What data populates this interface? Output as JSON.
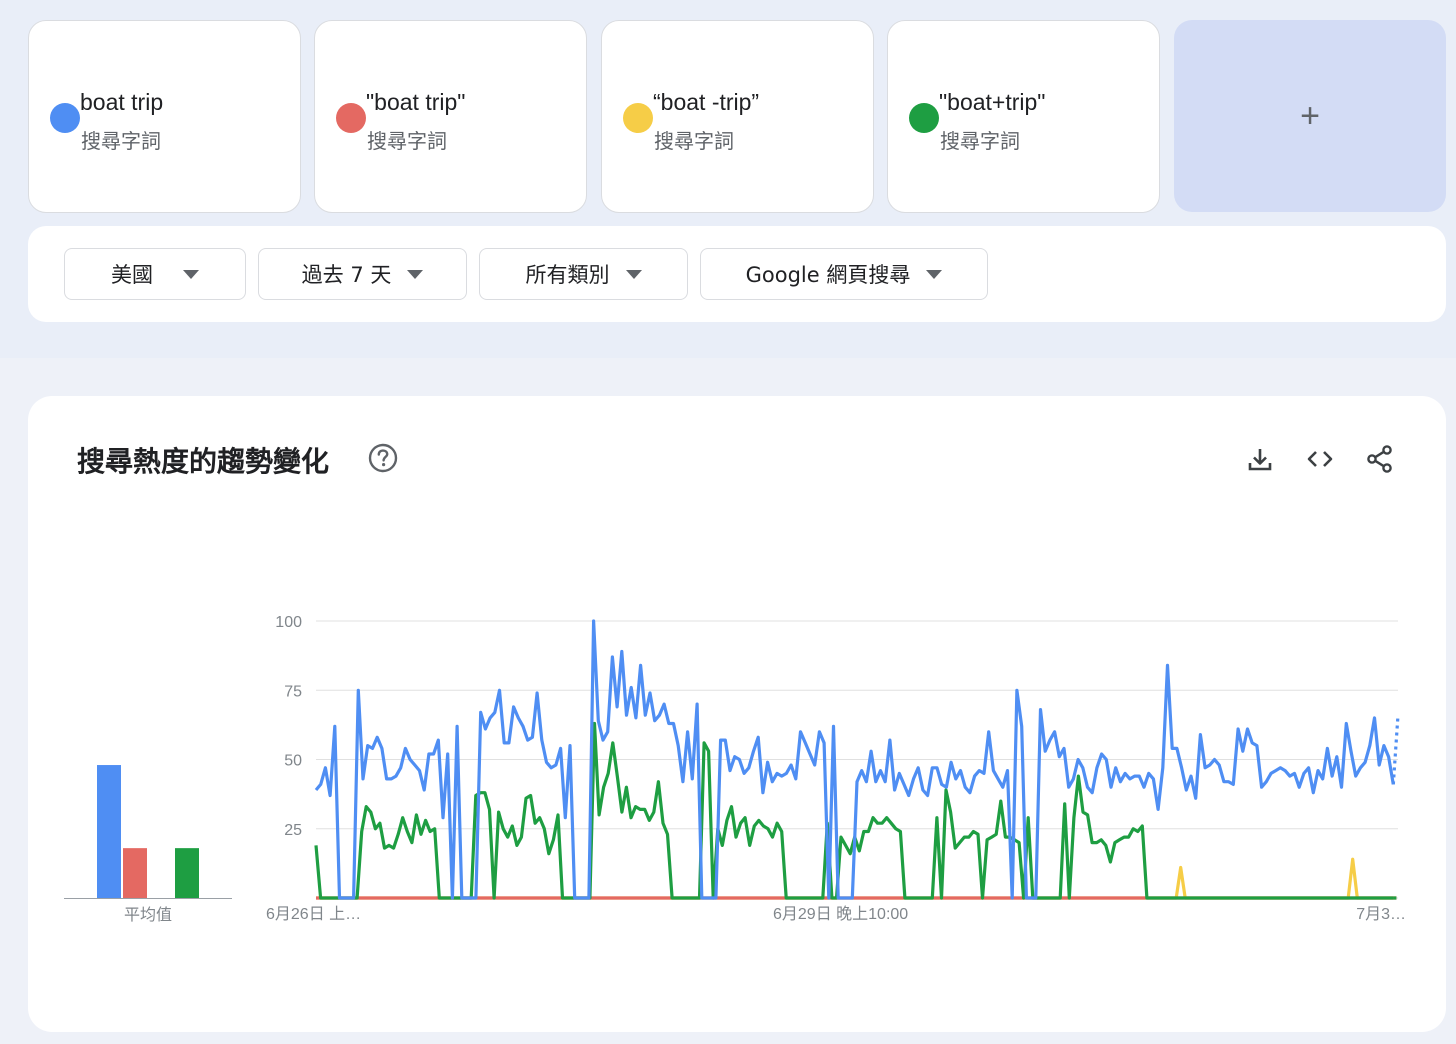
{
  "terms": [
    {
      "label": "boat trip",
      "sub": "搜尋字詞",
      "color": "#4f8ef3"
    },
    {
      "label": "\"boat trip\"",
      "sub": "搜尋字詞",
      "color": "#e46962"
    },
    {
      "label": "“boat -trip”",
      "sub": "搜尋字詞",
      "color": "#f6cd47"
    },
    {
      "label": "\"boat+trip\"",
      "sub": "搜尋字詞",
      "color": "#1e9e42"
    }
  ],
  "add_label": "+",
  "filters": {
    "region": "美國",
    "time": "過去 7 天",
    "category": "所有類別",
    "source": "Google 網頁搜尋"
  },
  "section_title": "搜尋熱度的趨勢變化",
  "icons": {
    "help": "help-circle-icon",
    "download": "download-icon",
    "embed": "code-icon",
    "share": "share-icon"
  },
  "chart_data": [
    {
      "type": "bar",
      "categories": [
        "boat trip",
        "\"boat trip\"",
        "“boat -trip”",
        "\"boat+trip\""
      ],
      "values": [
        48,
        18,
        0,
        18
      ],
      "colors": [
        "#4f8ef3",
        "#e46962",
        "#f6cd47",
        "#1e9e42"
      ],
      "xlabel": "平均值",
      "ylim": [
        0,
        100
      ]
    },
    {
      "type": "line",
      "ylim": [
        0,
        100
      ],
      "yticks": [
        100,
        75,
        50,
        25
      ],
      "xtick_labels": [
        "6月26日 上…",
        "6月29日 晚上10:00",
        "7月3…"
      ],
      "grid": true,
      "last_segment_dotted": true,
      "series": [
        {
          "name": "boat trip",
          "color": "#4f8ef3",
          "values": [
            39,
            41,
            47,
            37,
            62,
            0,
            0,
            0,
            0,
            75,
            43,
            55,
            54,
            58,
            54,
            43,
            43,
            44,
            47,
            54,
            50,
            48,
            46,
            39,
            52,
            52,
            57,
            29,
            52,
            0,
            62,
            0,
            0,
            0,
            0,
            67,
            61,
            65,
            67,
            75,
            56,
            56,
            69,
            65,
            62,
            57,
            58,
            74,
            57,
            49,
            47,
            48,
            54,
            29,
            55,
            0,
            0,
            0,
            0,
            100,
            64,
            57,
            60,
            87,
            69,
            89,
            66,
            76,
            65,
            84,
            66,
            74,
            64,
            66,
            70,
            63,
            63,
            55,
            42,
            60,
            43,
            70,
            0,
            0,
            0,
            0,
            57,
            57,
            46,
            51,
            50,
            45,
            47,
            53,
            58,
            38,
            49,
            42,
            45,
            44,
            45,
            48,
            43,
            60,
            56,
            52,
            48,
            60,
            56,
            0,
            62,
            0,
            0,
            0,
            0,
            42,
            46,
            42,
            53,
            42,
            46,
            42,
            57,
            39,
            45,
            41,
            37,
            43,
            47,
            39,
            37,
            47,
            47,
            41,
            40,
            49,
            43,
            46,
            40,
            38,
            44,
            46,
            45,
            60,
            46,
            43,
            40,
            46,
            0,
            75,
            62,
            0,
            0,
            0,
            68,
            53,
            57,
            60,
            51,
            54,
            40,
            43,
            50,
            47,
            40,
            38,
            47,
            52,
            50,
            40,
            47,
            42,
            45,
            43,
            44,
            44,
            40,
            45,
            43,
            32,
            47,
            84,
            54,
            54,
            47,
            39,
            44,
            36,
            59,
            47,
            48,
            50,
            48,
            42,
            42,
            41,
            61,
            53,
            61,
            56,
            55,
            40,
            42,
            45,
            46,
            47,
            46,
            44,
            45,
            40,
            45,
            47,
            38,
            46,
            43,
            54,
            44,
            51,
            40,
            63,
            53,
            44,
            47,
            49,
            55,
            65,
            48,
            55,
            51,
            41,
            66
          ]
        },
        {
          "name": "\"boat trip\"",
          "color": "#e46962",
          "values": [
            0,
            0,
            0,
            0,
            0,
            0,
            0,
            0,
            0,
            0,
            0,
            0,
            0,
            0,
            0,
            0,
            0,
            0,
            0,
            0,
            0,
            0,
            0,
            0,
            0,
            0,
            0,
            0,
            0,
            0,
            0,
            0,
            0,
            0,
            0,
            0,
            0,
            0,
            0,
            0,
            0,
            0,
            0,
            0,
            0,
            0,
            0,
            0,
            0,
            0,
            0,
            0,
            0,
            0,
            0,
            0,
            0,
            0,
            0,
            0,
            0,
            0,
            0,
            0,
            0,
            0,
            0,
            0,
            0,
            0,
            0,
            0,
            0,
            0,
            0,
            0,
            0,
            0,
            0,
            0,
            0,
            0,
            0,
            0,
            0,
            0,
            0,
            0,
            0,
            0,
            0,
            0,
            0,
            0,
            0,
            0,
            0,
            0,
            0,
            0,
            0,
            0,
            0,
            0,
            0,
            0,
            0,
            0,
            0,
            0,
            0,
            0,
            0,
            0,
            0,
            0,
            0,
            0,
            0,
            0,
            0,
            0,
            0,
            0,
            0,
            0,
            0,
            0,
            0,
            0,
            0,
            0,
            0,
            0,
            0,
            0,
            0,
            0,
            0,
            0,
            0,
            0,
            0,
            0,
            0,
            0,
            0,
            0,
            0,
            0,
            0,
            0,
            0,
            0,
            0,
            0,
            0,
            0,
            0,
            0,
            0,
            0,
            0,
            0,
            0,
            0,
            0,
            0,
            0,
            0,
            0,
            0,
            0,
            0,
            0,
            0,
            0,
            0,
            0,
            0,
            0,
            0,
            0,
            0,
            0,
            0,
            0,
            0,
            0,
            0,
            0,
            0,
            0,
            0,
            0,
            0,
            0,
            0,
            0,
            0,
            0,
            0,
            0,
            0,
            0,
            0,
            0,
            0,
            0,
            0,
            0,
            0,
            0,
            0,
            0,
            0,
            0,
            0,
            0,
            0,
            0,
            0,
            0,
            0,
            0,
            0,
            0,
            0,
            0,
            0,
            0,
            0,
            0,
            0,
            0,
            0,
            0,
            0,
            0,
            0
          ]
        },
        {
          "name": "“boat -trip”",
          "color": "#f6cd47",
          "values": [
            0,
            0,
            0,
            0,
            0,
            0,
            0,
            0,
            0,
            0,
            0,
            0,
            0,
            0,
            0,
            0,
            0,
            0,
            0,
            0,
            0,
            0,
            0,
            0,
            0,
            0,
            0,
            0,
            0,
            0,
            0,
            0,
            0,
            0,
            0,
            0,
            0,
            0,
            0,
            0,
            0,
            0,
            0,
            0,
            0,
            0,
            0,
            0,
            0,
            0,
            0,
            0,
            0,
            0,
            0,
            0,
            0,
            0,
            0,
            0,
            0,
            0,
            0,
            0,
            0,
            0,
            0,
            0,
            0,
            0,
            0,
            0,
            0,
            0,
            0,
            0,
            0,
            0,
            0,
            0,
            0,
            0,
            0,
            0,
            0,
            0,
            0,
            0,
            0,
            0,
            0,
            0,
            0,
            0,
            0,
            0,
            0,
            0,
            0,
            0,
            0,
            0,
            0,
            0,
            0,
            0,
            0,
            0,
            0,
            0,
            0,
            0,
            0,
            0,
            0,
            0,
            0,
            0,
            0,
            0,
            0,
            0,
            0,
            0,
            0,
            0,
            0,
            0,
            0,
            0,
            0,
            0,
            0,
            0,
            0,
            0,
            0,
            0,
            0,
            0,
            0,
            0,
            0,
            0,
            0,
            0,
            0,
            0,
            0,
            0,
            0,
            0,
            0,
            0,
            0,
            0,
            0,
            0,
            0,
            0,
            0,
            0,
            0,
            0,
            0,
            0,
            0,
            0,
            0,
            0,
            0,
            0,
            0,
            0,
            0,
            0,
            0,
            0,
            0,
            0,
            0,
            0,
            0,
            0,
            0,
            0,
            0,
            0,
            0,
            0,
            0,
            11,
            0,
            0,
            0,
            0,
            0,
            0,
            0,
            0,
            0,
            0,
            0,
            0,
            0,
            0,
            0,
            0,
            0,
            0,
            0,
            0,
            0,
            0,
            0,
            0,
            0,
            0,
            0,
            0,
            0,
            0,
            0,
            0,
            0,
            0,
            0,
            0,
            0,
            14,
            0,
            0,
            0,
            0,
            0,
            0,
            0,
            0,
            0,
            0
          ]
        },
        {
          "name": "\"boat+trip\"",
          "color": "#1e9e42",
          "values": [
            19,
            0,
            0,
            0,
            0,
            0,
            0,
            0,
            0,
            0,
            24,
            33,
            31,
            25,
            27,
            18,
            19,
            18,
            23,
            29,
            24,
            20,
            30,
            23,
            28,
            24,
            25,
            0,
            0,
            0,
            0,
            0,
            0,
            0,
            0,
            37,
            38,
            38,
            32,
            0,
            31,
            25,
            22,
            26,
            19,
            22,
            36,
            37,
            27,
            29,
            25,
            16,
            21,
            30,
            0,
            0,
            0,
            0,
            0,
            0,
            0,
            63,
            30,
            40,
            45,
            56,
            44,
            31,
            40,
            29,
            33,
            32,
            32,
            28,
            31,
            42,
            27,
            23,
            0,
            0,
            0,
            0,
            0,
            0,
            0,
            56,
            53,
            0,
            25,
            19,
            28,
            33,
            22,
            27,
            29,
            19,
            26,
            28,
            26,
            25,
            22,
            27,
            24,
            0,
            0,
            0,
            0,
            0,
            0,
            0,
            0,
            0,
            27,
            0,
            0,
            22,
            19,
            16,
            22,
            17,
            24,
            24,
            29,
            27,
            27,
            29,
            27,
            25,
            24,
            0,
            0,
            0,
            0,
            0,
            0,
            0,
            29,
            0,
            39,
            31,
            18,
            20,
            22,
            22,
            24,
            23,
            0,
            21,
            22,
            23,
            35,
            22,
            22,
            21,
            20,
            0,
            29,
            0,
            0,
            0,
            0,
            0,
            0,
            0,
            34,
            0,
            29,
            44,
            31,
            30,
            20,
            20,
            21,
            19,
            13,
            20,
            21,
            22,
            22,
            25,
            24,
            26,
            0,
            0,
            0,
            0,
            0,
            0,
            0,
            0,
            0,
            0,
            0,
            0,
            0,
            0,
            0,
            0,
            0,
            0,
            0,
            0,
            0,
            0,
            0,
            0,
            0,
            0,
            0,
            0,
            0,
            0,
            0,
            0,
            0,
            0,
            0,
            0,
            0,
            0,
            0,
            0,
            0,
            0,
            0,
            0,
            0,
            0,
            0,
            0,
            0,
            0,
            0,
            0,
            0,
            0,
            0,
            0
          ]
        }
      ]
    }
  ]
}
